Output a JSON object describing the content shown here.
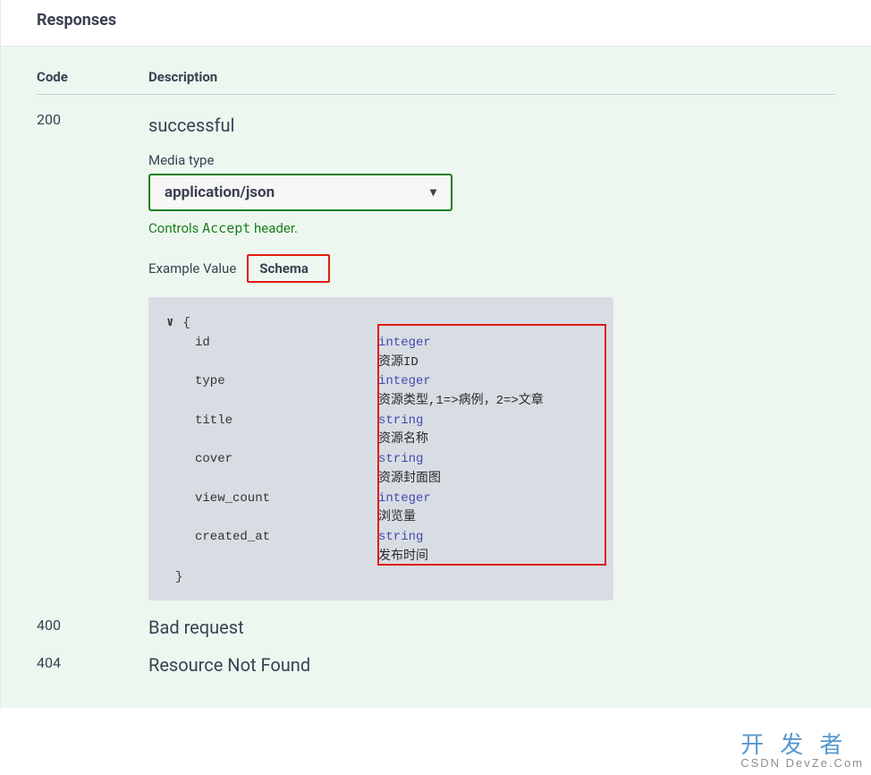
{
  "header": {
    "title": "Responses"
  },
  "table": {
    "code_header": "Code",
    "desc_header": "Description"
  },
  "rows": [
    {
      "code": "200",
      "description": "successful",
      "media_label": "Media type",
      "media_value": "application/json",
      "controls_prefix": "Controls ",
      "controls_code": "Accept",
      "controls_suffix": " header.",
      "tabs": {
        "example": "Example Value",
        "schema": "Schema"
      },
      "schema": {
        "open": "{",
        "close": "}",
        "props": [
          {
            "name": "id",
            "type": "integer",
            "desc": "资源ID"
          },
          {
            "name": "type",
            "type": "integer",
            "desc": "资源类型,1=>病例，2=>文章"
          },
          {
            "name": "title",
            "type": "string",
            "desc": "资源名称"
          },
          {
            "name": "cover",
            "type": "string",
            "desc": "资源封面图"
          },
          {
            "name": "view_count",
            "type": "integer",
            "desc": "浏览量"
          },
          {
            "name": "created_at",
            "type": "string",
            "desc": "发布时间"
          }
        ]
      }
    },
    {
      "code": "400",
      "description": "Bad request"
    },
    {
      "code": "404",
      "description": "Resource Not Found"
    }
  ],
  "watermark": {
    "main": "开发者",
    "sub": "CSDN DevZe.Com"
  }
}
